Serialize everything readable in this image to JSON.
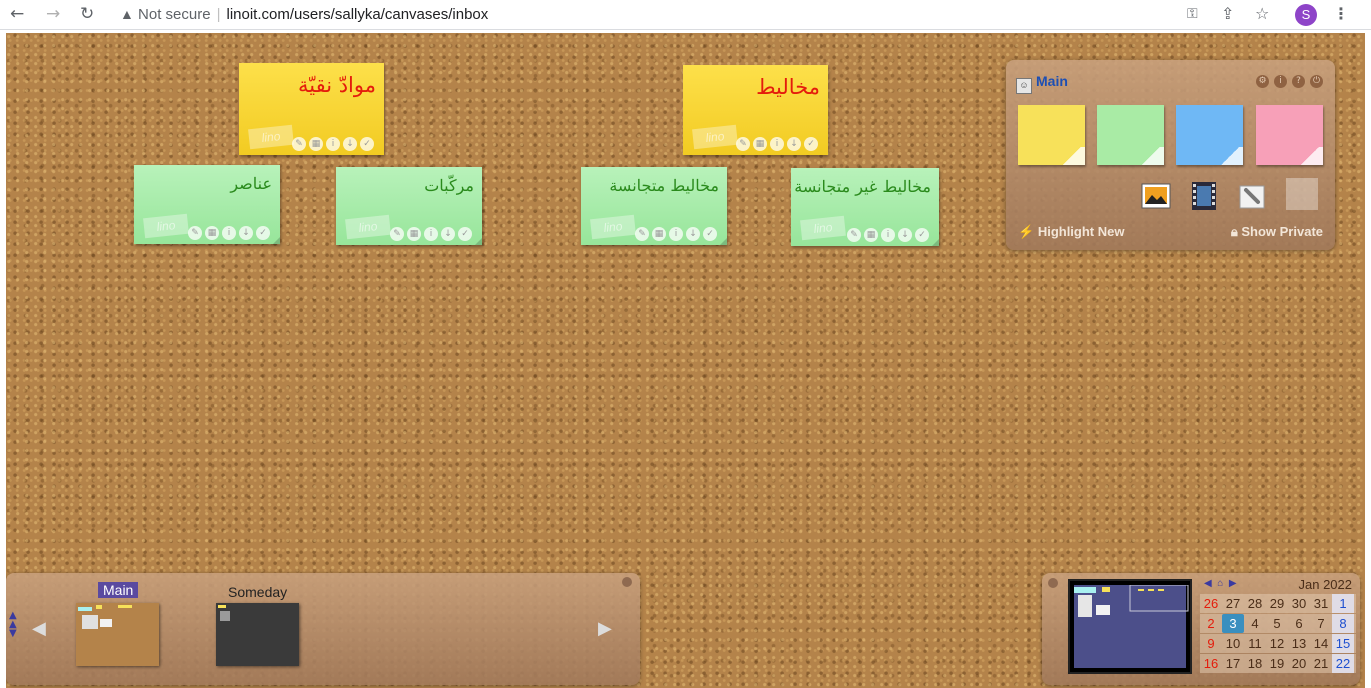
{
  "browser": {
    "security_label": "Not secure",
    "url": "linoit.com/users/sallyka/canvases/inbox",
    "profile_initial": "S"
  },
  "notes": [
    {
      "color": "yellow",
      "text": "موادّ نقيّة"
    },
    {
      "color": "yellow",
      "text": "مخاليط"
    },
    {
      "color": "green",
      "text": "عناصر"
    },
    {
      "color": "green",
      "text": "مركّبات"
    },
    {
      "color": "green",
      "text": "مخاليط متجانسة"
    },
    {
      "color": "green",
      "text": "مخاليط غير متجانسة"
    }
  ],
  "note_brand": "lino",
  "palette": {
    "title": "Main",
    "highlight_label": "Highlight New",
    "show_private_label": "Show Private",
    "swatch_colors": [
      "#f7e15a",
      "#a9eba5",
      "#6fb8f5",
      "#f7a0b8"
    ]
  },
  "canvases": [
    {
      "label": "Main",
      "selected": true
    },
    {
      "label": "Someday",
      "selected": false
    }
  ],
  "calendar": {
    "month": "Jan 2022",
    "weeks": [
      [
        "26",
        "27",
        "28",
        "29",
        "30",
        "31",
        "1"
      ],
      [
        "2",
        "3",
        "4",
        "5",
        "6",
        "7",
        "8"
      ],
      [
        "9",
        "10",
        "11",
        "12",
        "13",
        "14",
        "15"
      ],
      [
        "16",
        "17",
        "18",
        "19",
        "20",
        "21",
        "22"
      ]
    ],
    "today": "3"
  }
}
